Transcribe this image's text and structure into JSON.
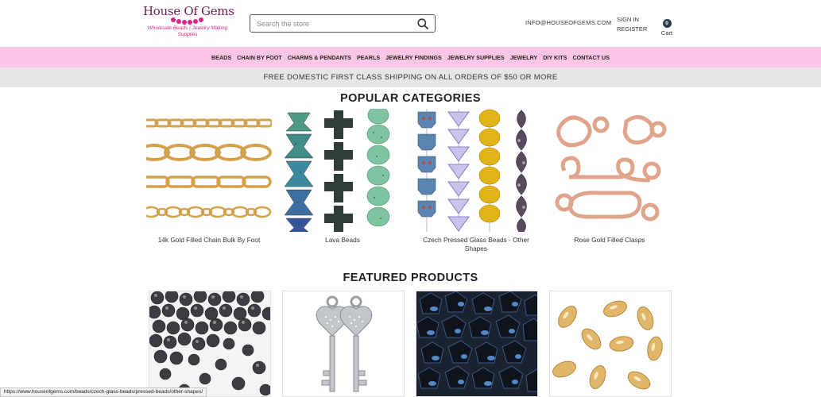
{
  "header": {
    "logo_title": "House Of Gems",
    "logo_tagline": "Wholesale Beads | Jewelry Making Supplies",
    "search_placeholder": "Search the store",
    "email": "INFO@HOUSEOFGEMS.COM",
    "sign_in": "SIGN IN",
    "register": "REGISTER",
    "cart_count": "0",
    "cart_label": "Cart"
  },
  "nav": {
    "items": [
      "BEADS",
      "CHAIN BY FOOT",
      "CHARMS & PENDANTS",
      "PEARLS",
      "JEWELRY FINDINGS",
      "JEWELRY SUPPLIES",
      "JEWELRY",
      "DIY KITS",
      "CONTACT US"
    ]
  },
  "promo": {
    "text": "FREE DOMESTIC FIRST CLASS SHIPPING ON ALL ORDERS OF $50 OR MORE"
  },
  "popular": {
    "title": "POPULAR CATEGORIES",
    "items": [
      {
        "label": "14k Gold Filled Chain Bulk By Foot",
        "icon": "gold-chain-image"
      },
      {
        "label": "Lava Beads",
        "icon": "lava-beads-image"
      },
      {
        "label": "Czech Pressed Glass Beads - Other Shapes",
        "icon": "czech-glass-beads-image"
      },
      {
        "label": "Rose Gold Filled Clasps",
        "icon": "rose-gold-clasps-image"
      }
    ]
  },
  "featured": {
    "title": "FEATURED PRODUCTS",
    "items": [
      {
        "icon": "hematite-beads-image"
      },
      {
        "icon": "silver-heart-key-charms-image"
      },
      {
        "icon": "black-blue-glass-beads-image"
      },
      {
        "icon": "gold-oval-beads-image"
      }
    ]
  },
  "status_bar": {
    "url": "https://www.houseofgems.com/beads/czech-glass-beads/pressed-beads/other-shapes/"
  },
  "colors": {
    "nav_bg": "#fcc7e6",
    "promo_bg": "#e6e6e6",
    "brand_pink": "#e0218a",
    "logo_text": "#6b1f4f"
  }
}
